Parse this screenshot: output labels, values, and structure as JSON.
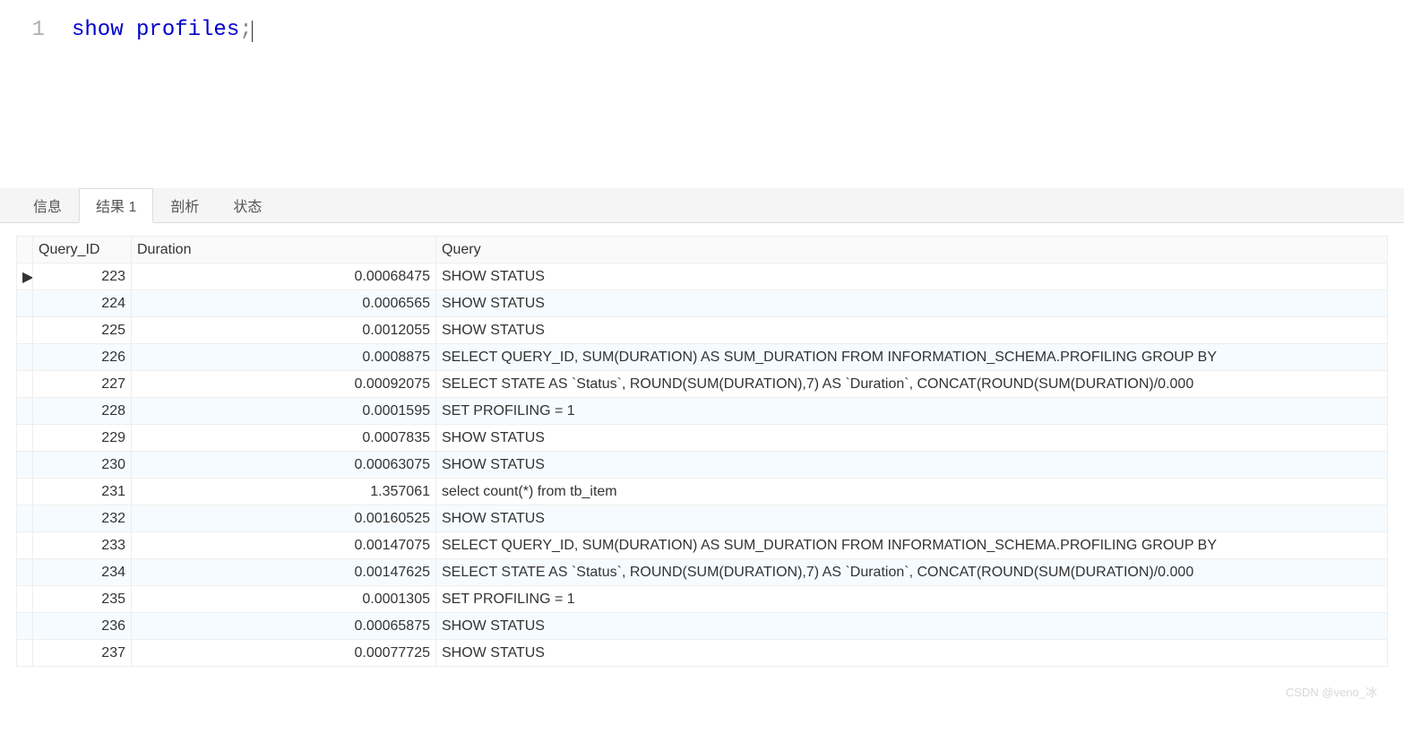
{
  "editor": {
    "line_number": "1",
    "keyword1": "show",
    "keyword2": "profiles",
    "sym": ";"
  },
  "tabs": {
    "items": [
      "信息",
      "结果 1",
      "剖析",
      "状态"
    ],
    "active_index": 1
  },
  "table": {
    "columns": [
      "Query_ID",
      "Duration",
      "Query"
    ],
    "rows": [
      {
        "selected": true,
        "query_id": "223",
        "duration": "0.00068475",
        "query": "SHOW STATUS"
      },
      {
        "selected": false,
        "query_id": "224",
        "duration": "0.0006565",
        "query": "SHOW STATUS"
      },
      {
        "selected": false,
        "query_id": "225",
        "duration": "0.0012055",
        "query": "SHOW STATUS"
      },
      {
        "selected": false,
        "query_id": "226",
        "duration": "0.0008875",
        "query": "SELECT QUERY_ID, SUM(DURATION) AS SUM_DURATION FROM INFORMATION_SCHEMA.PROFILING GROUP BY"
      },
      {
        "selected": false,
        "query_id": "227",
        "duration": "0.00092075",
        "query": "SELECT STATE AS `Status`, ROUND(SUM(DURATION),7) AS `Duration`, CONCAT(ROUND(SUM(DURATION)/0.000"
      },
      {
        "selected": false,
        "query_id": "228",
        "duration": "0.0001595",
        "query": "SET PROFILING = 1"
      },
      {
        "selected": false,
        "query_id": "229",
        "duration": "0.0007835",
        "query": "SHOW STATUS"
      },
      {
        "selected": false,
        "query_id": "230",
        "duration": "0.00063075",
        "query": "SHOW STATUS"
      },
      {
        "selected": false,
        "query_id": "231",
        "duration": "1.357061",
        "query": "select count(*) from tb_item"
      },
      {
        "selected": false,
        "query_id": "232",
        "duration": "0.00160525",
        "query": "SHOW STATUS"
      },
      {
        "selected": false,
        "query_id": "233",
        "duration": "0.00147075",
        "query": "SELECT QUERY_ID, SUM(DURATION) AS SUM_DURATION FROM INFORMATION_SCHEMA.PROFILING GROUP BY"
      },
      {
        "selected": false,
        "query_id": "234",
        "duration": "0.00147625",
        "query": "SELECT STATE AS `Status`, ROUND(SUM(DURATION),7) AS `Duration`, CONCAT(ROUND(SUM(DURATION)/0.000"
      },
      {
        "selected": false,
        "query_id": "235",
        "duration": "0.0001305",
        "query": "SET PROFILING = 1"
      },
      {
        "selected": false,
        "query_id": "236",
        "duration": "0.00065875",
        "query": "SHOW STATUS"
      },
      {
        "selected": false,
        "query_id": "237",
        "duration": "0.00077725",
        "query": "SHOW STATUS"
      }
    ],
    "row_marker": "▶"
  },
  "watermark": "CSDN @veno_冰"
}
